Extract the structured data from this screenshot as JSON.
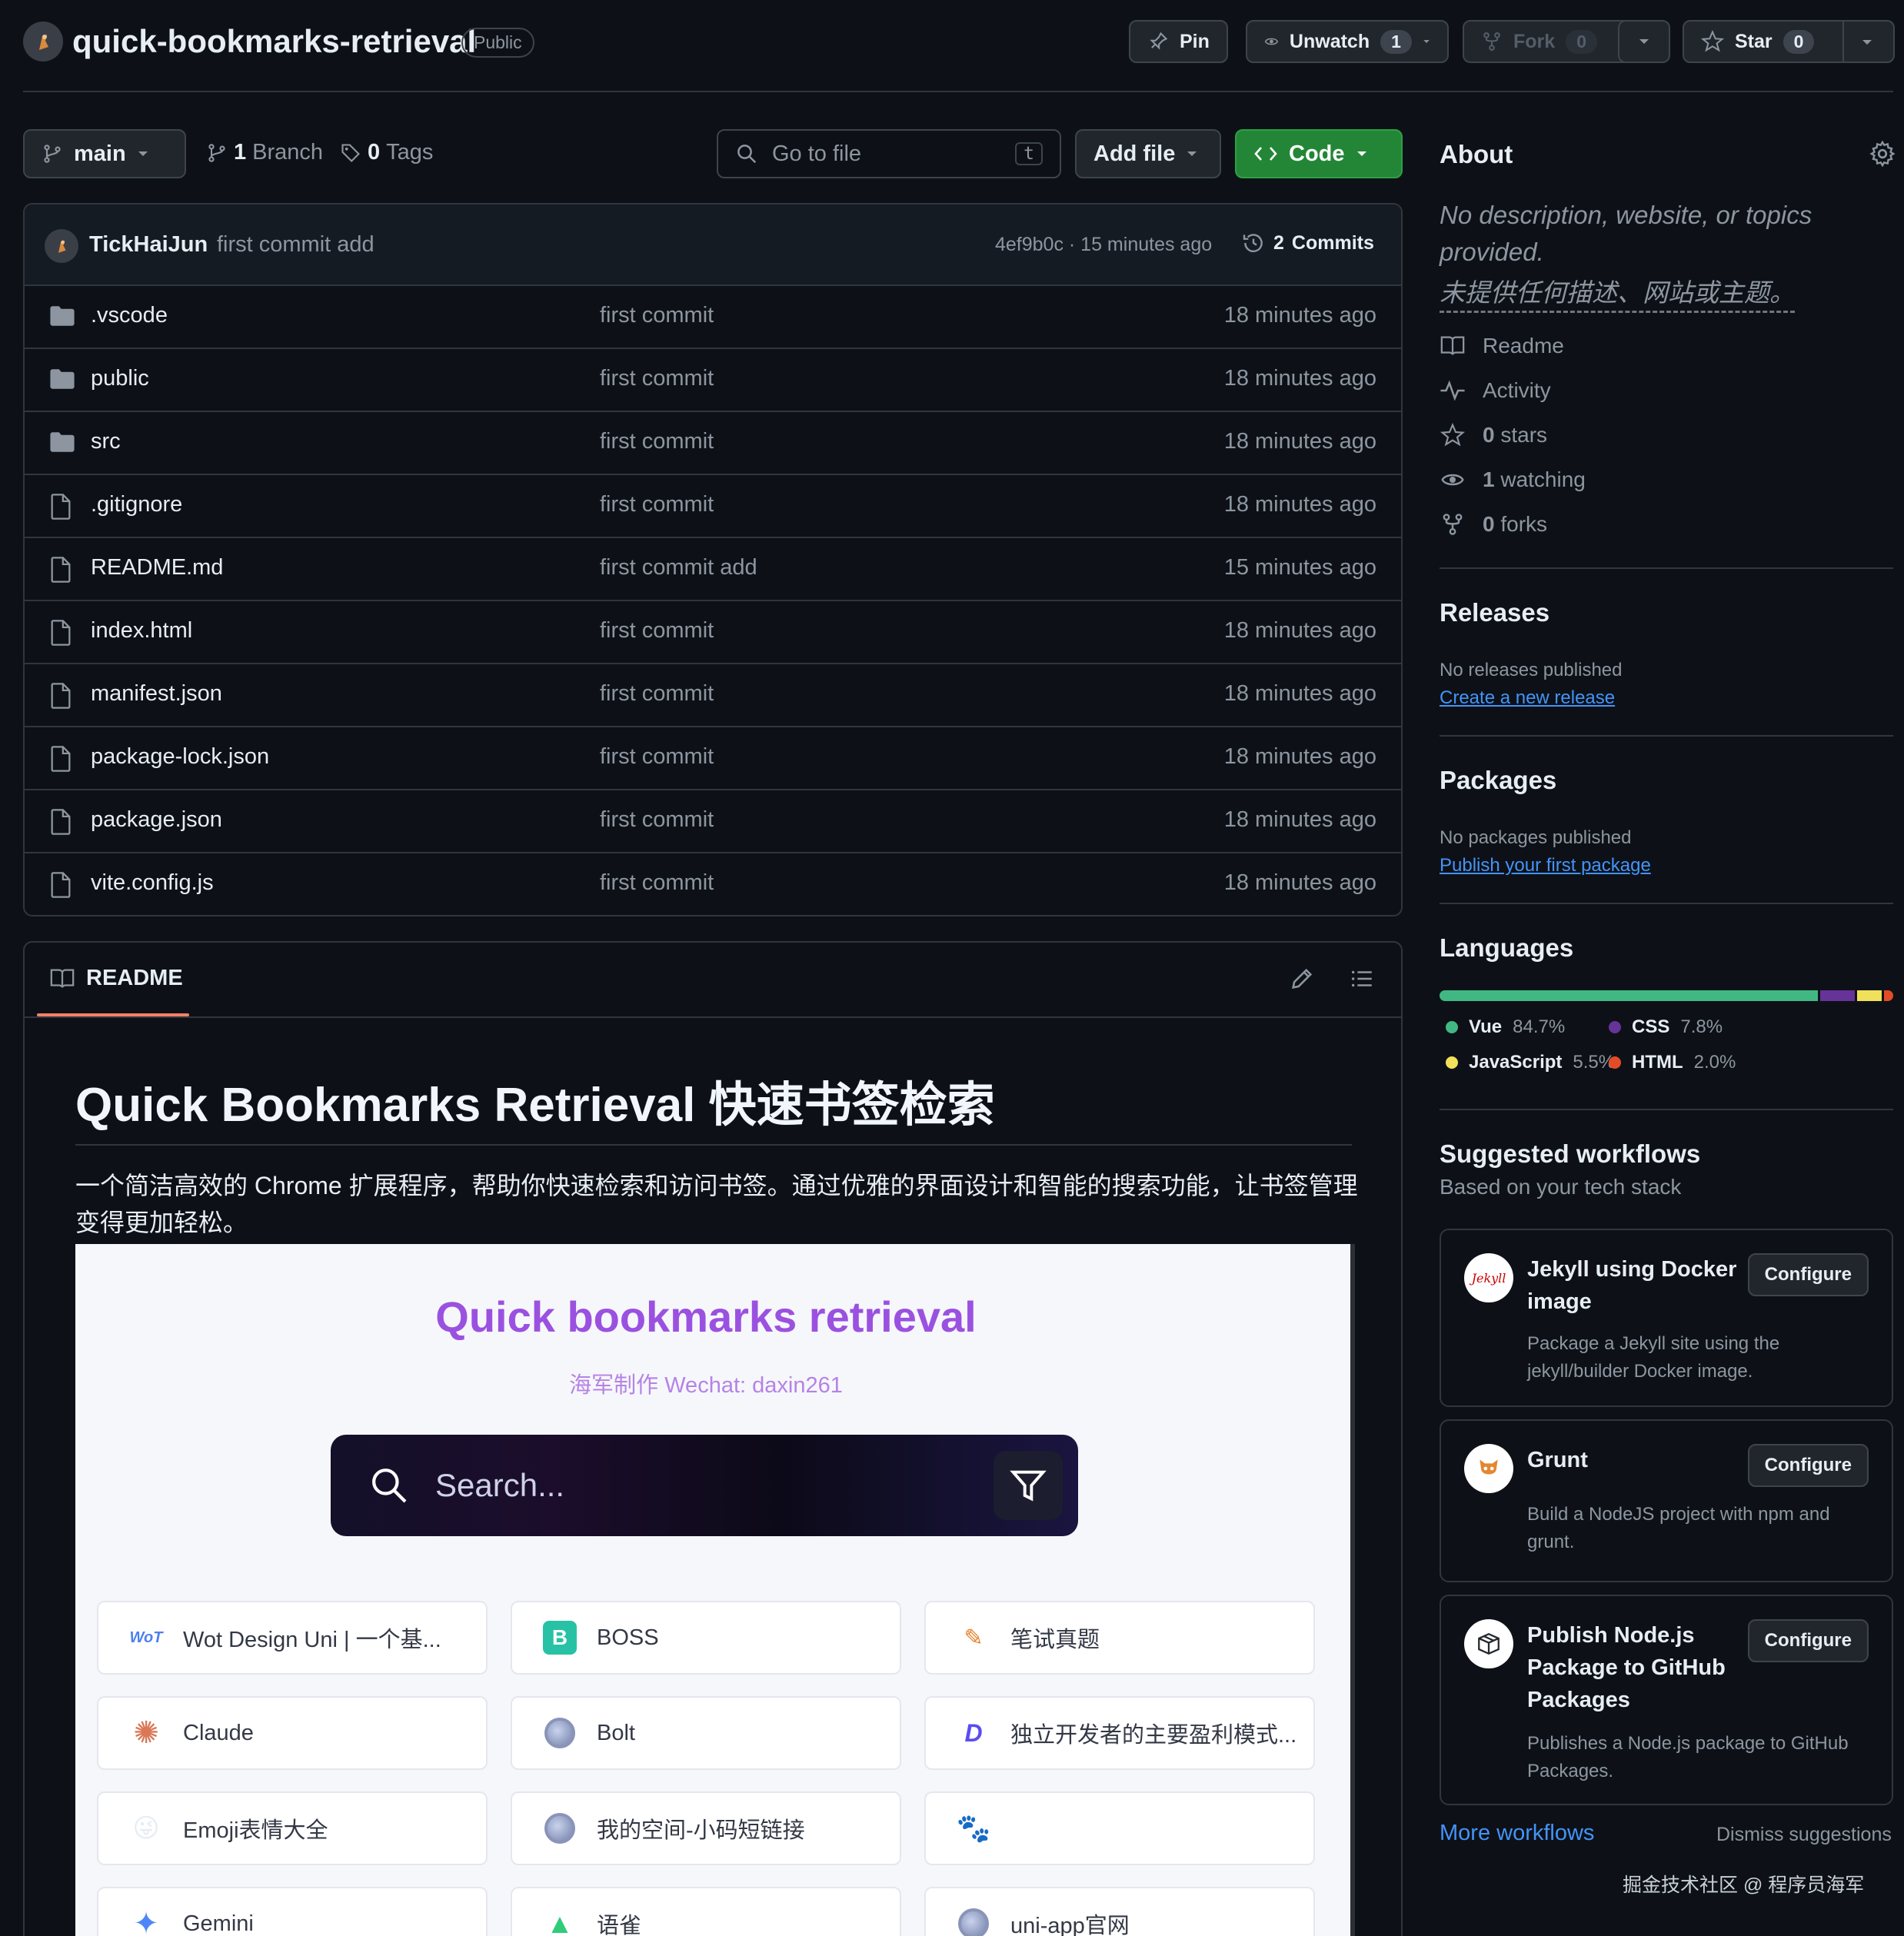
{
  "repo": {
    "name": "quick-bookmarks-retrieval",
    "visibility": "Public",
    "actions": {
      "pin": "Pin",
      "unwatch": "Unwatch",
      "watch_count": "1",
      "fork": "Fork",
      "fork_count": "0",
      "star": "Star",
      "star_count": "0"
    }
  },
  "toolbar": {
    "branch": "main",
    "branch_count": "1",
    "branch_label": "Branch",
    "tag_count": "0",
    "tag_label": "Tags",
    "search_placeholder": "Go to file",
    "search_shortcut": "t",
    "add_file": "Add file",
    "code": "Code"
  },
  "latest_commit": {
    "author": "TickHaiJun",
    "message": "first commit add",
    "meta": "4ef9b0c · 15 minutes ago",
    "commits_count": "2",
    "commits_label": "Commits"
  },
  "files": [
    {
      "name": ".vscode",
      "type": "folder",
      "message": "first commit",
      "time": "18 minutes ago"
    },
    {
      "name": "public",
      "type": "folder",
      "message": "first commit",
      "time": "18 minutes ago"
    },
    {
      "name": "src",
      "type": "folder",
      "message": "first commit",
      "time": "18 minutes ago"
    },
    {
      "name": ".gitignore",
      "type": "file",
      "message": "first commit",
      "time": "18 minutes ago"
    },
    {
      "name": "README.md",
      "type": "file",
      "message": "first commit add",
      "time": "15 minutes ago"
    },
    {
      "name": "index.html",
      "type": "file",
      "message": "first commit",
      "time": "18 minutes ago"
    },
    {
      "name": "manifest.json",
      "type": "file",
      "message": "first commit",
      "time": "18 minutes ago"
    },
    {
      "name": "package-lock.json",
      "type": "file",
      "message": "first commit",
      "time": "18 minutes ago"
    },
    {
      "name": "package.json",
      "type": "file",
      "message": "first commit",
      "time": "18 minutes ago"
    },
    {
      "name": "vite.config.js",
      "type": "file",
      "message": "first commit",
      "time": "18 minutes ago"
    }
  ],
  "readme": {
    "tab": "README",
    "title": "Quick Bookmarks Retrieval 快速书签检索",
    "intro": "一个简洁高效的 Chrome 扩展程序，帮助你快速检索和访问书签。通过优雅的界面设计和智能的搜索功能，让书签管理变得更加轻松。",
    "preview": {
      "title": "Quick bookmarks retrieval",
      "subtitle": "海军制作 Wechat: daxin261",
      "search_placeholder": "Search...",
      "cards": [
        {
          "label": "Wot Design Uni | 一个基...",
          "icon": "wot-logo"
        },
        {
          "label": "BOSS",
          "icon": "boss-logo"
        },
        {
          "label": "笔试真题",
          "icon": "exam-logo"
        },
        {
          "label": "Claude",
          "icon": "claude-logo"
        },
        {
          "label": "Bolt",
          "icon": "globe-icon"
        },
        {
          "label": "独立开发者的主要盈利模式...",
          "icon": "d-logo"
        },
        {
          "label": "Emoji表情大全",
          "icon": "emoji-logo"
        },
        {
          "label": "我的空间-小码短链接",
          "icon": "globe-icon"
        },
        {
          "label": "",
          "icon": "baidu-logo"
        },
        {
          "label": "Gemini",
          "icon": "gemini-logo"
        },
        {
          "label": "语雀",
          "icon": "yuque-logo"
        },
        {
          "label": "uni-app官网",
          "icon": "globe-icon"
        }
      ]
    }
  },
  "about": {
    "title": "About",
    "description": "No description, website, or topics provided.",
    "description_cn": "未提供任何描述、网站或主题。",
    "readme": "Readme",
    "activity": "Activity",
    "stars_count": "0",
    "stars_label": "stars",
    "watching_count": "1",
    "watching_label": "watching",
    "forks_count": "0",
    "forks_label": "forks"
  },
  "releases": {
    "title": "Releases",
    "empty": "No releases published",
    "link": "Create a new release"
  },
  "packages": {
    "title": "Packages",
    "empty": "No packages published",
    "link": "Publish your first package"
  },
  "languages": {
    "title": "Languages",
    "items": [
      {
        "name": "Vue",
        "percent": "84.7%",
        "value": 84.7,
        "color": "#41b883"
      },
      {
        "name": "CSS",
        "percent": "7.8%",
        "value": 7.8,
        "color": "#663399"
      },
      {
        "name": "JavaScript",
        "percent": "5.5%",
        "value": 5.5,
        "color": "#f1e05a"
      },
      {
        "name": "HTML",
        "percent": "2.0%",
        "value": 2.0,
        "color": "#e34c26"
      }
    ]
  },
  "workflows": {
    "title": "Suggested workflows",
    "subtitle": "Based on your tech stack",
    "items": [
      {
        "name": "Jekyll using Docker image",
        "desc": "Package a Jekyll site using the jekyll/builder Docker image.",
        "button": "Configure",
        "icon": "jekyll-logo"
      },
      {
        "name": "Grunt",
        "desc": "Build a NodeJS project with npm and grunt.",
        "button": "Configure",
        "icon": "grunt-logo"
      },
      {
        "name": "Publish Node.js Package to GitHub Packages",
        "desc": "Publishes a Node.js package to GitHub Packages.",
        "button": "Configure",
        "icon": "package-logo"
      }
    ],
    "more": "More workflows",
    "dismiss": "Dismiss suggestions"
  },
  "watermark": "掘金技术社区 @ 程序员海军",
  "colors": {
    "background": "#0d1117",
    "accent_green": "#238636",
    "link_blue": "#4493f8",
    "readme_tab_underline": "#f78166",
    "preview_title_purple": "#9b51e0"
  }
}
